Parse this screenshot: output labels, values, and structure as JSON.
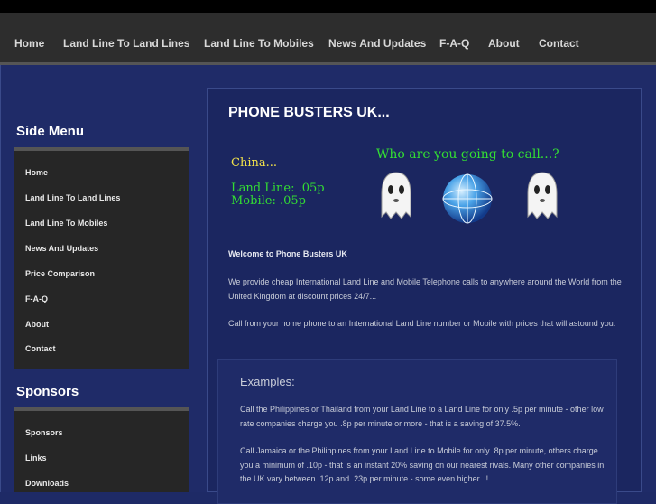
{
  "nav": {
    "items": [
      {
        "label": "Home"
      },
      {
        "label": "Land Line To Land Lines"
      },
      {
        "label": "Land Line To Mobiles"
      },
      {
        "label": "News And Updates"
      },
      {
        "label": "F-A-Q"
      },
      {
        "label": "About"
      },
      {
        "label": "Contact"
      }
    ]
  },
  "sidebar": {
    "menu_heading": "Side Menu",
    "menu_items": [
      {
        "label": "Home"
      },
      {
        "label": "Land Line To Land Lines"
      },
      {
        "label": "Land Line To Mobiles"
      },
      {
        "label": "News And Updates"
      },
      {
        "label": "Price Comparison"
      },
      {
        "label": "F-A-Q"
      },
      {
        "label": "About"
      },
      {
        "label": "Contact"
      }
    ],
    "sponsors_heading": "Sponsors",
    "sponsor_items": [
      {
        "label": "Sponsors"
      },
      {
        "label": "Links"
      },
      {
        "label": "Downloads"
      }
    ]
  },
  "main": {
    "title": "PHONE BUSTERS UK...",
    "banner": {
      "country": "China...",
      "land_line": "Land Line: .05p",
      "mobile": "Mobile: .05p",
      "tagline": "Who are you going to call...?"
    },
    "welcome": "Welcome to Phone Busters UK",
    "intro": "We provide cheap International Land Line and Mobile Telephone calls to anywhere around the World from the United Kingdom at discount prices 24/7...",
    "call_from": "Call from your home phone to an International Land Line number or Mobile with prices that will astound you.",
    "examples": {
      "heading": "Examples:",
      "items": [
        "Call the Philippines or Thailand from your Land Line to a Land Line for only .5p per minute - other low rate companies charge you .8p per minute or more - that is a saving of 37.5%.",
        "Call Jamaica or the Philippines from your Land Line to Mobile for only .8p per minute, others charge you a minimum of .10p - that is an instant 20% saving on our nearest rivals. Many other companies in the UK vary between .12p and .23p per minute - some even higher...!"
      ]
    }
  },
  "colors": {
    "background": "#1e2a66",
    "nav_bar": "#2d2d2d",
    "rate_green": "#33dd33",
    "country_yellow": "#f2e24a"
  },
  "icons": [
    "ghost-icon",
    "globe-icon",
    "ghost-icon"
  ]
}
